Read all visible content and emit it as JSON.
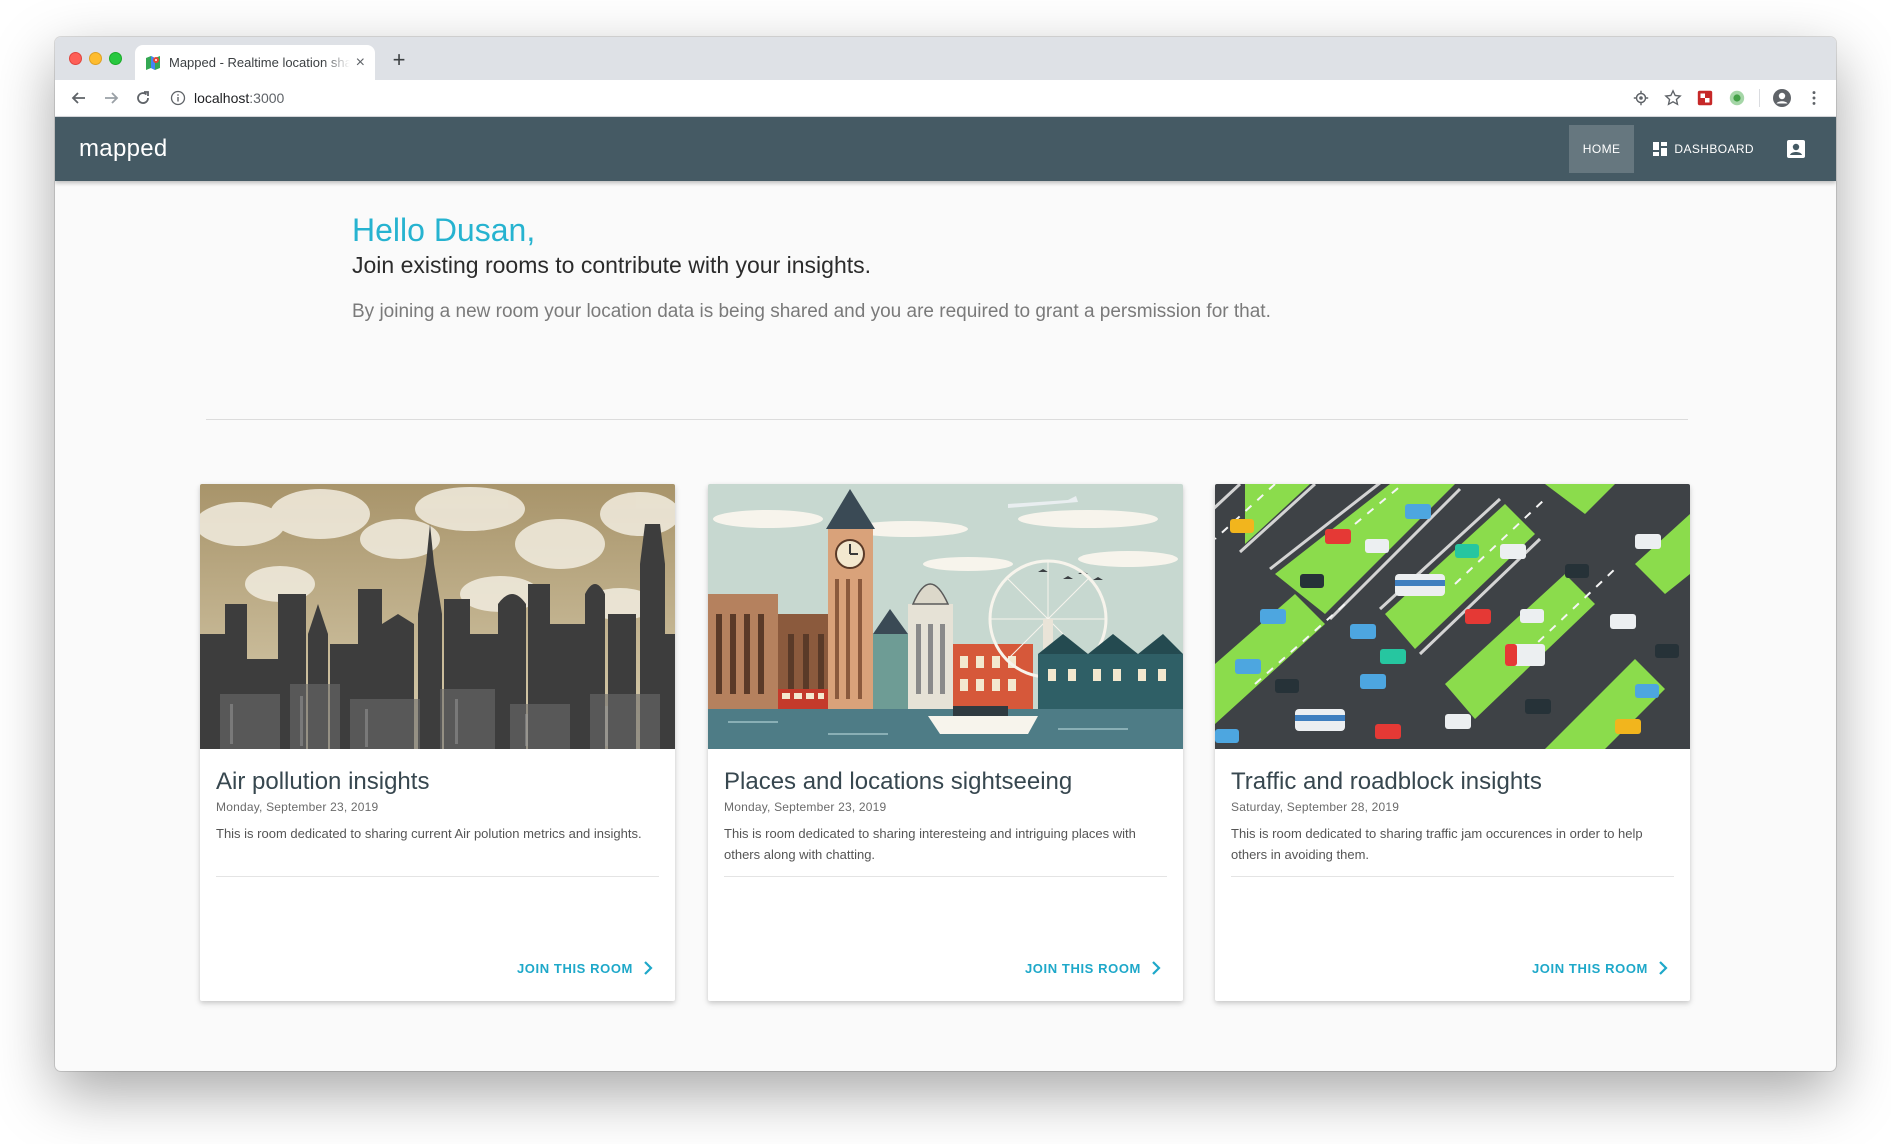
{
  "browser": {
    "tab_title": "Mapped - Realtime location sharing",
    "tab_close": "×",
    "new_tab": "+",
    "url_host": "localhost",
    "url_port": ":3000"
  },
  "appbar": {
    "brand": "mapped",
    "nav": {
      "home": "HOME",
      "dashboard": "DASHBOARD"
    },
    "color": "#455a64"
  },
  "hero": {
    "greeting": "Hello Dusan,",
    "subtitle": "Join existing rooms to contribute with your insights.",
    "notice": "By joining a new room your location data is being shared and you are required to grant a persmission for that."
  },
  "rooms": [
    {
      "title": "Air pollution insights",
      "date": "Monday, September 23, 2019",
      "description": "This is room dedicated to sharing current Air polution metrics and insights.",
      "action": "JOIN THIS ROOM",
      "image_icon": "city-smog-illustration"
    },
    {
      "title": "Places and locations sightseeing",
      "date": "Monday, September 23, 2019",
      "description": "This is room dedicated to sharing interesteing and intriguing places with others along with chatting.",
      "action": "JOIN THIS ROOM",
      "image_icon": "london-landmarks-illustration"
    },
    {
      "title": "Traffic and roadblock insights",
      "date": "Saturday, September 28, 2019",
      "description": "This is room dedicated to sharing traffic jam occurences in order to help others in avoiding them.",
      "action": "JOIN THIS ROOM",
      "image_icon": "traffic-jam-illustration"
    }
  ],
  "colors": {
    "accent": "#26b3d0",
    "action": "#1ea8c9"
  }
}
